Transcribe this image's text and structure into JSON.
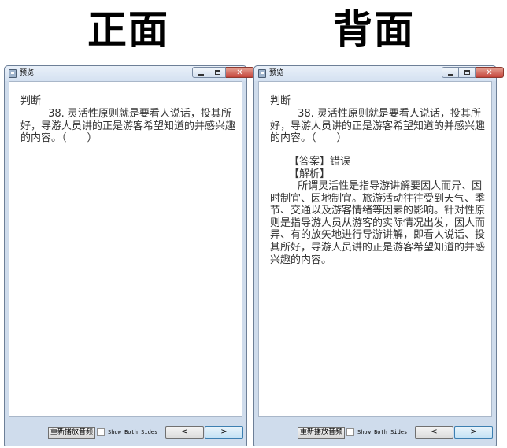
{
  "headings": {
    "front": "正面",
    "back": "背面"
  },
  "window": {
    "title": "预览"
  },
  "card": {
    "type": "判断",
    "question": "38. 灵活性原则就是要看人说话，投其所好，导游人员讲的正是游客希望知道的并感兴趣的内容。（　　）",
    "answer_label": "【答案】",
    "answer_value": "错误",
    "analysis_label": "【解析】",
    "analysis": "所谓灵活性是指导游讲解要因人而异、因时制宜、因地制宜。旅游活动往往受到天气、季节、交通以及游客情绪等因素的影响。针对性原则是指导游人员从游客的实际情况出发，因人而异、有的放矢地进行导游讲解，即看人说话、投其所好，导游人员讲的正是游客希望知道的并感兴趣的内容。"
  },
  "controls": {
    "replay_label": "重新播放音频",
    "show_both_label": "Show Both Sides",
    "show_both_checked": false,
    "prev_label": "<",
    "next_label": ">"
  },
  "icons": {
    "app": "app-window-icon",
    "minimize": "minimize-icon",
    "maximize": "maximize-icon",
    "close": "close-icon"
  },
  "colors": {
    "title_bar": "#d4e1f1",
    "close_button": "#c4443a",
    "next_button_border": "#3c7fb1"
  }
}
